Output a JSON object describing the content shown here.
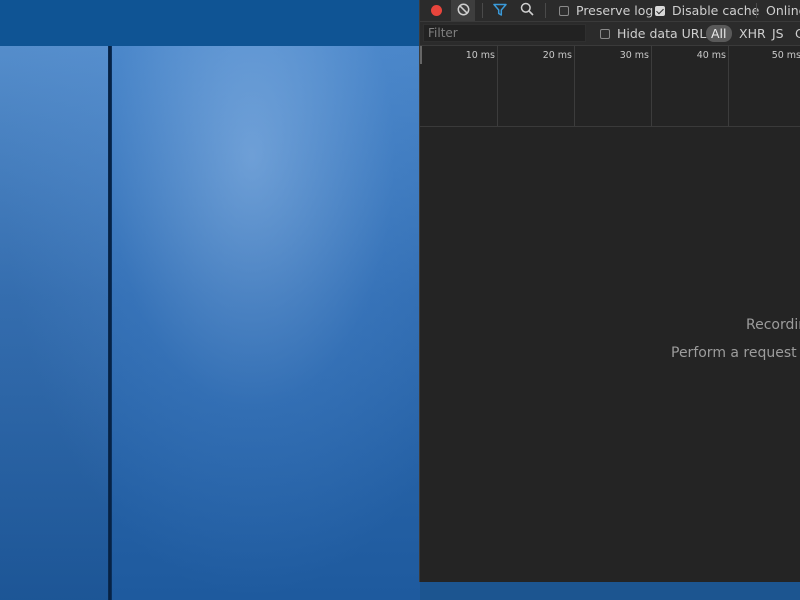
{
  "devtools": {
    "toolbar": {
      "record_icon": "record-icon",
      "clear_icon": "clear-icon",
      "filter_icon": "filter-icon",
      "search_icon": "search-icon",
      "preserve_log_label": "Preserve log",
      "preserve_log_checked": false,
      "disable_cache_label": "Disable cache",
      "disable_cache_checked": true,
      "throttling_value": "Online"
    },
    "filterbar": {
      "filter_placeholder": "Filter",
      "hide_data_urls_label": "Hide data URLs",
      "hide_data_urls_checked": false,
      "resource_types": [
        "All",
        "XHR",
        "JS",
        "C"
      ],
      "selected_type": "All"
    },
    "timeline": {
      "ticks": [
        "10 ms",
        "20 ms",
        "30 ms",
        "40 ms",
        "50 ms"
      ]
    },
    "empty_state": {
      "title": "Recordin",
      "hint": "Perform a request or"
    },
    "colors": {
      "record": "#e8453c",
      "panel_bg": "#242424",
      "toolbar_bg": "#2b2b2b",
      "filter_accent": "#3a9ad9"
    }
  },
  "page": {
    "header_color": "#0f5494",
    "body_color": "#2f6bb0"
  }
}
